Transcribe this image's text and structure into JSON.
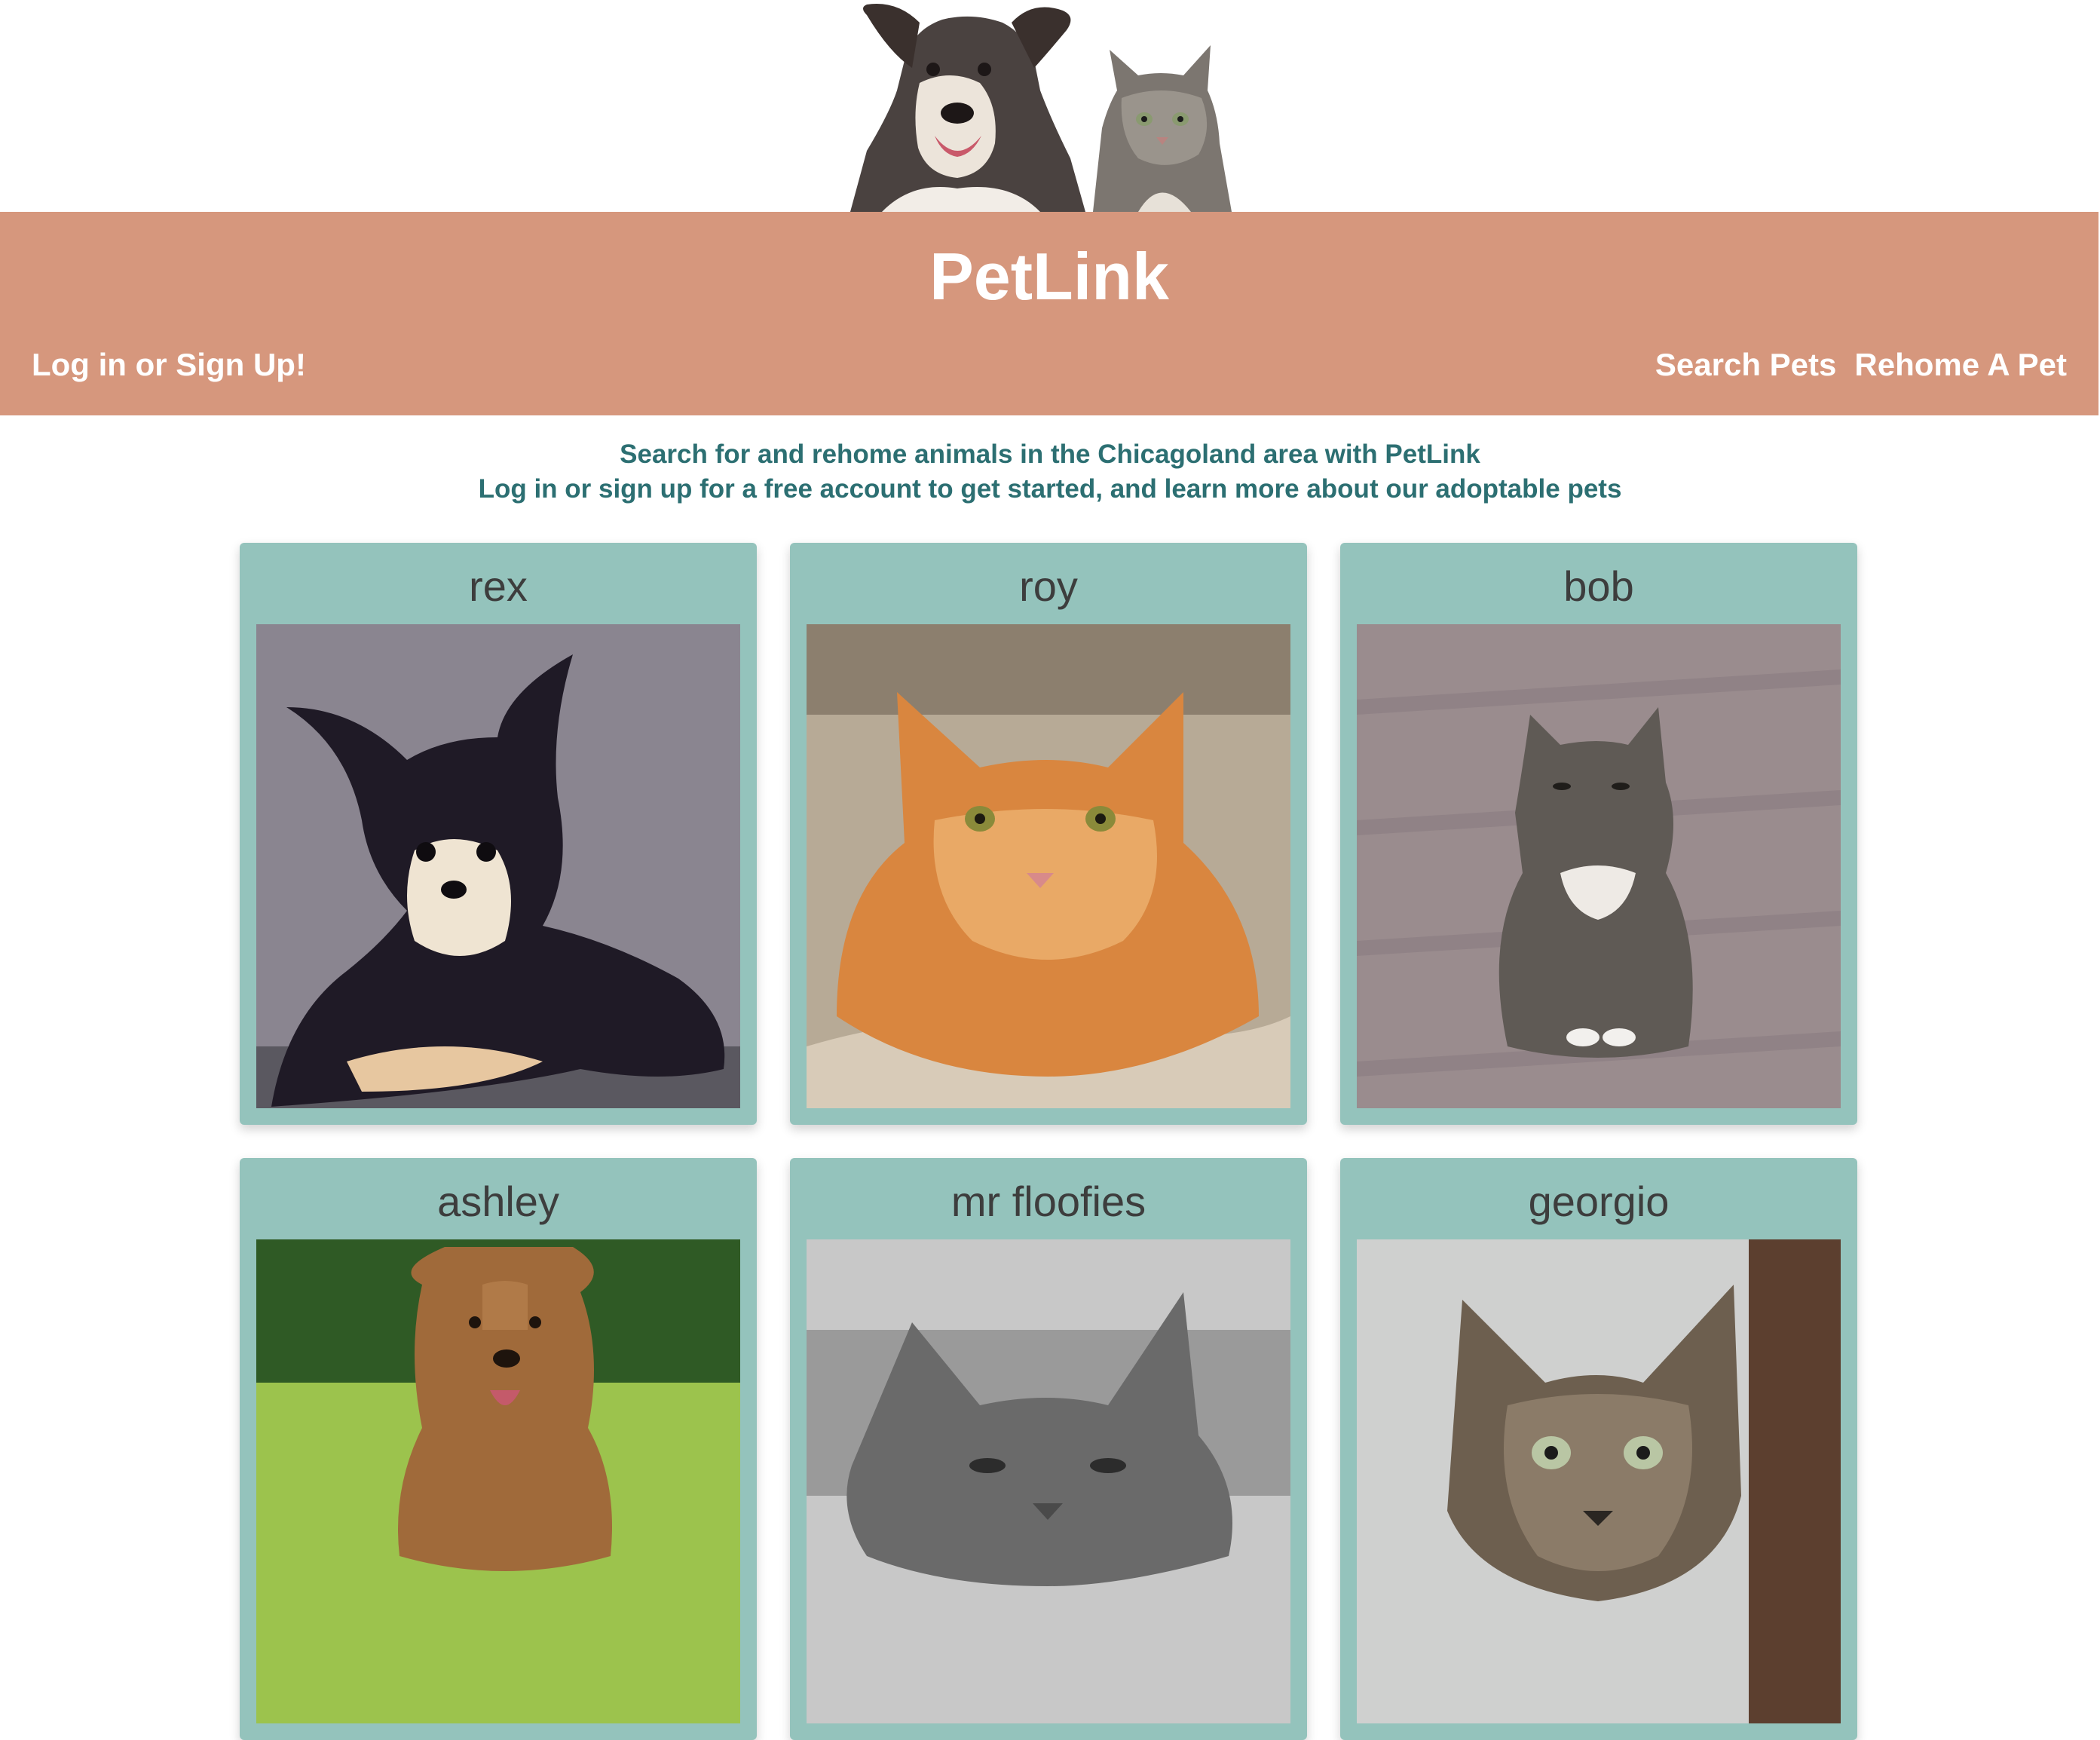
{
  "header": {
    "brand": "PetLink",
    "login_link": "Log in or Sign Up!",
    "nav": [
      "Search Pets",
      "Rehome A Pet"
    ]
  },
  "intro": {
    "line1": "Search for and rehome animals in the Chicagoland area with PetLink",
    "line2": "Log in or sign up for a free account to get started, and learn more about our adoptable pets"
  },
  "pets": [
    {
      "name": "rex"
    },
    {
      "name": "roy"
    },
    {
      "name": "bob"
    },
    {
      "name": "ashley"
    },
    {
      "name": "mr floofies"
    },
    {
      "name": "georgio"
    }
  ],
  "colors": {
    "header_bg": "#d6977d",
    "card_bg": "#94c3bc",
    "intro_text": "#2c6f72",
    "pet_name_text": "#3d3d3d"
  }
}
